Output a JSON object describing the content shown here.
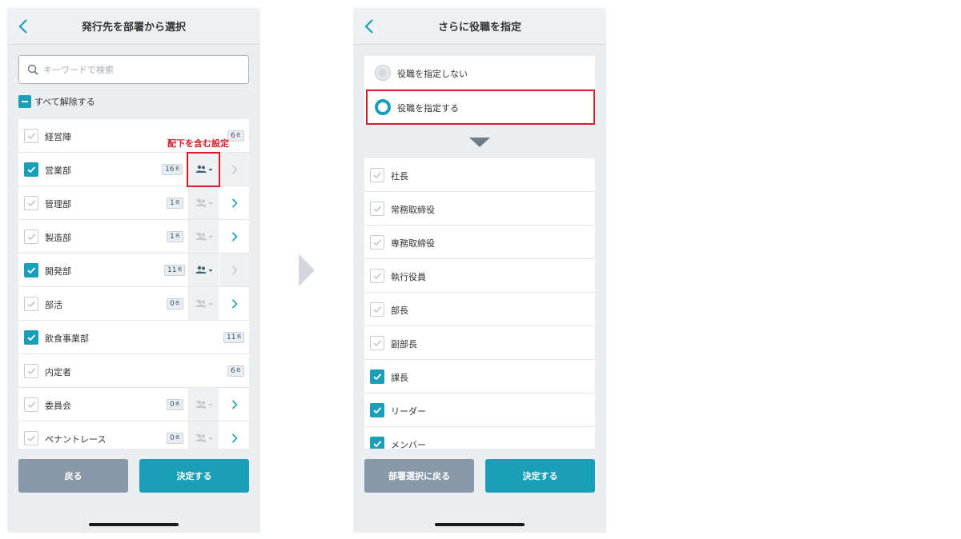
{
  "left_screen": {
    "title": "発行先を部署から選択",
    "search_placeholder": "キーワードで検索",
    "clear_all_label": "すべて解除する",
    "annotation_label": "配下を含む設定",
    "count_unit": "名",
    "departments": [
      {
        "name": "経営陣",
        "count": "6",
        "checked": false
      },
      {
        "name": "営業部",
        "count": "16",
        "checked": true
      },
      {
        "name": "管理部",
        "count": "1",
        "checked": false
      },
      {
        "name": "製造部",
        "count": "1",
        "checked": false
      },
      {
        "name": "開発部",
        "count": "11",
        "checked": true
      },
      {
        "name": "部活",
        "count": "0",
        "checked": false
      },
      {
        "name": "飲食事業部",
        "count": "11",
        "checked": true
      },
      {
        "name": "内定者",
        "count": "6",
        "checked": false
      },
      {
        "name": "委員会",
        "count": "0",
        "checked": false
      },
      {
        "name": "ペナントレース",
        "count": "0",
        "checked": false
      }
    ],
    "back_button": "戻る",
    "confirm_button": "決定する"
  },
  "right_screen": {
    "title": "さらに役職を指定",
    "radio_no_role": "役職を指定しない",
    "radio_specify_role": "役職を指定する",
    "roles": [
      {
        "name": "社長",
        "checked": false
      },
      {
        "name": "常務取締役",
        "checked": false
      },
      {
        "name": "専務取締役",
        "checked": false
      },
      {
        "name": "執行役員",
        "checked": false
      },
      {
        "name": "部長",
        "checked": false
      },
      {
        "name": "副部長",
        "checked": false
      },
      {
        "name": "課長",
        "checked": true
      },
      {
        "name": "リーダー",
        "checked": true
      },
      {
        "name": "メンバー",
        "checked": true
      }
    ],
    "back_button": "部署選択に戻る",
    "confirm_button": "決定する"
  },
  "colors": {
    "accent": "#1a9fb8",
    "annotation": "#d1202b",
    "button_gray": "#8898a6",
    "background": "#ebeef1"
  },
  "icons": [
    "chevron-left-icon",
    "search-icon",
    "people-icon",
    "people-excluded-icon",
    "caret-down-icon",
    "chevron-right-icon",
    "check-icon",
    "triangle-down-icon",
    "triangle-right-icon"
  ]
}
